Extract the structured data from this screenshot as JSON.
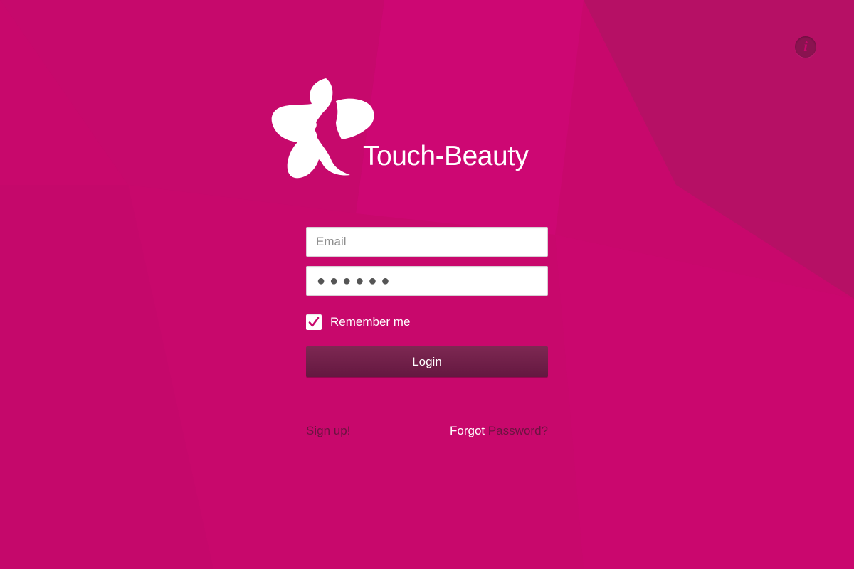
{
  "app": {
    "name": "Touch-Beauty"
  },
  "colors": {
    "background": "#c8086c",
    "button": "#722046",
    "link_dark": "#6a1440",
    "text_light": "#ffffff"
  },
  "header": {
    "info_icon": "info-icon",
    "info_glyph": "i"
  },
  "form": {
    "email_placeholder": "Email",
    "email_value": "",
    "password_mask": "●●●●●●",
    "remember_label": "Remember me",
    "remember_checked": true,
    "login_label": "Login"
  },
  "links": {
    "signup": "Sign up!",
    "forgot_word1": "Forgot",
    "forgot_word2": "Password?"
  }
}
